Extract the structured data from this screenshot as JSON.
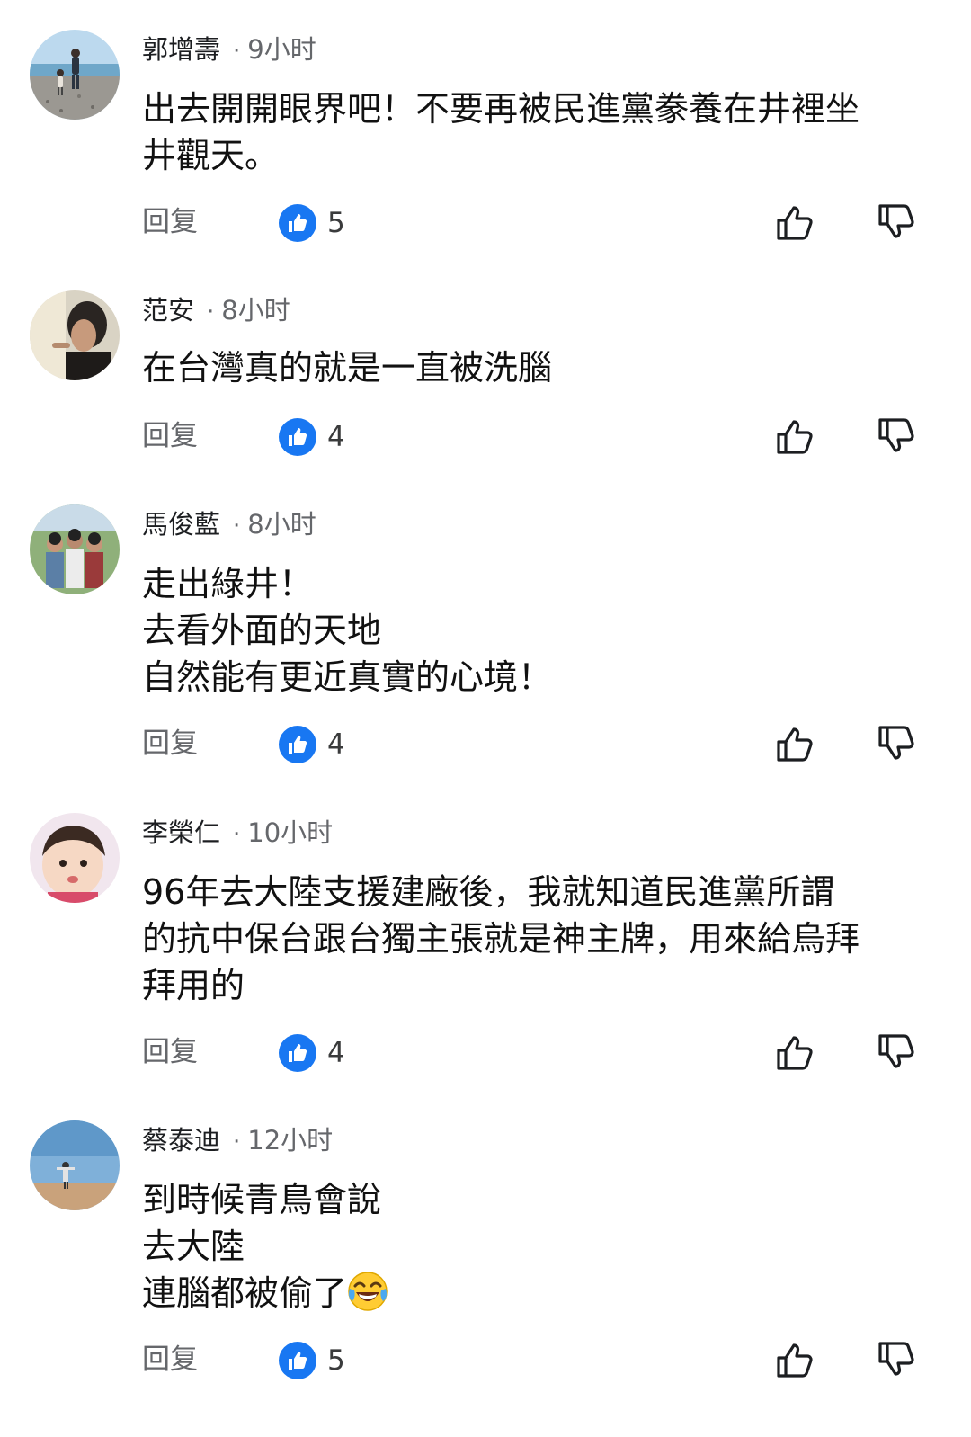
{
  "reply_label": "回复",
  "accent_color": "#1877f2",
  "comments": [
    {
      "author": "郭增壽",
      "separator": "·",
      "time": "9小时",
      "lines": [
        "出去開開眼界吧！不要再被民進黨豢養在井裡坐",
        "井觀天。"
      ],
      "likes": "5",
      "avatar": "beach-photo"
    },
    {
      "author": "范安",
      "separator": "·",
      "time": "8小时",
      "lines": [
        "在台灣真的就是一直被洗腦"
      ],
      "likes": "4",
      "avatar": "portrait-photo"
    },
    {
      "author": "馬俊藍",
      "separator": "·",
      "time": "8小时",
      "lines": [
        "走出綠井！",
        "去看外面的天地",
        "自然能有更近真實的心境！"
      ],
      "likes": "4",
      "avatar": "group-photo"
    },
    {
      "author": "李榮仁",
      "separator": "·",
      "time": "10小时",
      "lines": [
        "96年去大陸支援建廠後，我就知道民進黨所謂",
        "的抗中保台跟台獨主張就是神主牌，用來給烏拜",
        "拜用的"
      ],
      "likes": "4",
      "avatar": "baby-photo"
    },
    {
      "author": "蔡泰迪",
      "separator": "·",
      "time": "12小时",
      "lines": [
        "到時候青鳥會說",
        "去大陸",
        "連腦都被偷了"
      ],
      "emoji": "face-with-tears-of-joy",
      "likes": "5",
      "avatar": "sky-photo"
    }
  ]
}
